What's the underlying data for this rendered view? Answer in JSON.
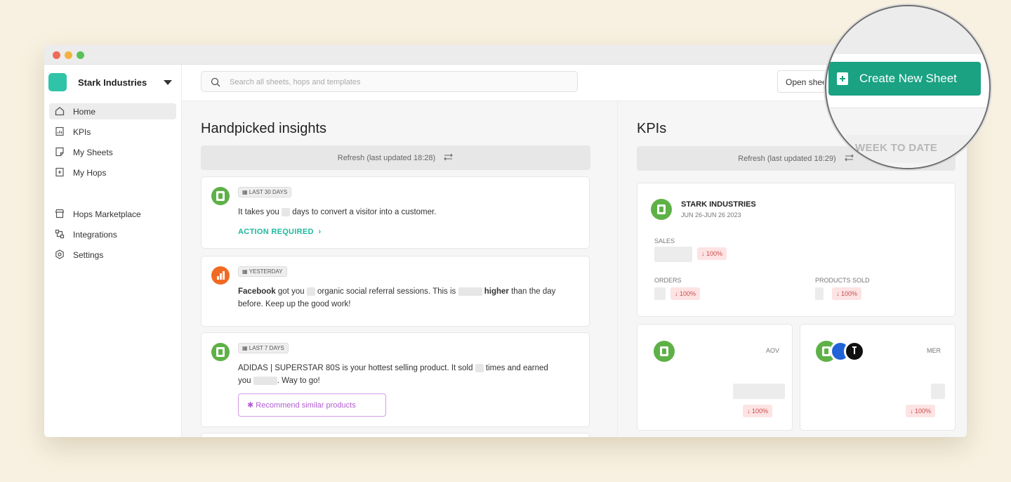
{
  "window": {
    "traffic_lights": [
      "close",
      "minimize",
      "zoom"
    ]
  },
  "sidebar": {
    "workspace_name": "Stark Industries",
    "items": [
      {
        "label": "Home",
        "icon": "home-icon",
        "active": true
      },
      {
        "label": "KPIs",
        "icon": "chart-doc-icon"
      },
      {
        "label": "My Sheets",
        "icon": "sheet-icon"
      },
      {
        "label": "My Hops",
        "icon": "hops-icon"
      },
      {
        "label": "Hops Marketplace",
        "icon": "store-icon"
      },
      {
        "label": "Integrations",
        "icon": "integrations-icon"
      },
      {
        "label": "Settings",
        "icon": "settings-icon"
      }
    ]
  },
  "topbar": {
    "search_placeholder": "Search all sheets, hops and templates",
    "open_sheet_label": "Open sheet",
    "create_label": "Create New Sheet"
  },
  "insights": {
    "title": "Handpicked insights",
    "refresh_label": "Refresh (last updated 18:28)",
    "cards": [
      {
        "period": "LAST 30 DAYS",
        "text_a": "It takes you",
        "text_b": "days to convert a visitor into a customer.",
        "action": "ACTION REQUIRED",
        "action_arrow": "›"
      },
      {
        "period": "YESTERDAY",
        "bold_a": "Facebook",
        "text_a": "got you",
        "text_b": "organic social referral sessions. This is",
        "bold_b": "higher",
        "text_c": "than the day",
        "text_d": "before. Keep up the good work!"
      },
      {
        "period": "LAST 7 DAYS",
        "product": "ADIDAS | SUPERSTAR 80S",
        "text_a": "is your hottest selling product. It sold",
        "text_b": "times and earned",
        "text_c": "you",
        "text_d": ". Way to go!",
        "button": "✱ Recommend similar products"
      }
    ]
  },
  "kpis": {
    "title": "KPIs",
    "refresh_label": "Refresh (last updated 18:29)",
    "period_select": "WEEK TO DATE",
    "store": {
      "name": "STARK INDUSTRIES",
      "date_range": "JUN 26-JUN 26 2023",
      "sales_label": "SALES",
      "sales_change": "↓ 100%",
      "orders_label": "ORDERS",
      "orders_change": "↓ 100%",
      "products_label": "PRODUCTS SOLD",
      "products_change": "↓ 100%"
    },
    "aov": {
      "label": "AOV",
      "change": "↓ 100%"
    },
    "mer": {
      "label": "MER",
      "change": "↓ 100%"
    }
  },
  "colors": {
    "accent": "#1aa283",
    "teal_text": "#1fb9a0",
    "shopify_green": "#5eb147",
    "negative_bg": "#fde3e3",
    "negative_text": "#c94d4d",
    "background": "#f8f1e1"
  }
}
